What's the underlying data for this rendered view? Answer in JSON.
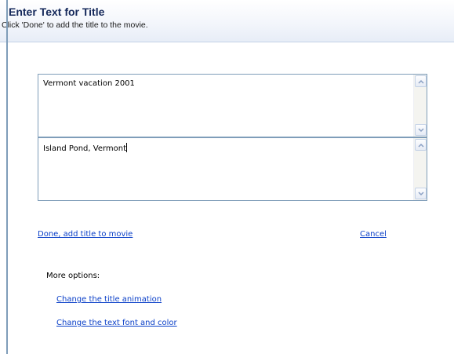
{
  "header": {
    "title": "Enter Text for Title",
    "subtitle": "Click 'Done' to add the title to the movie."
  },
  "title_fields": [
    {
      "value": "Vermont vacation 2001"
    },
    {
      "value": "Island Pond, Vermont"
    }
  ],
  "actions": {
    "done_label": "Done, add title to movie",
    "cancel_label": "Cancel"
  },
  "more_options": {
    "label": "More options:",
    "links": [
      {
        "label": "Change the title animation"
      },
      {
        "label": "Change the text font and color"
      }
    ]
  },
  "colors": {
    "link": "#0b40c8",
    "header_title": "#14285a",
    "border": "#7f9db9"
  }
}
